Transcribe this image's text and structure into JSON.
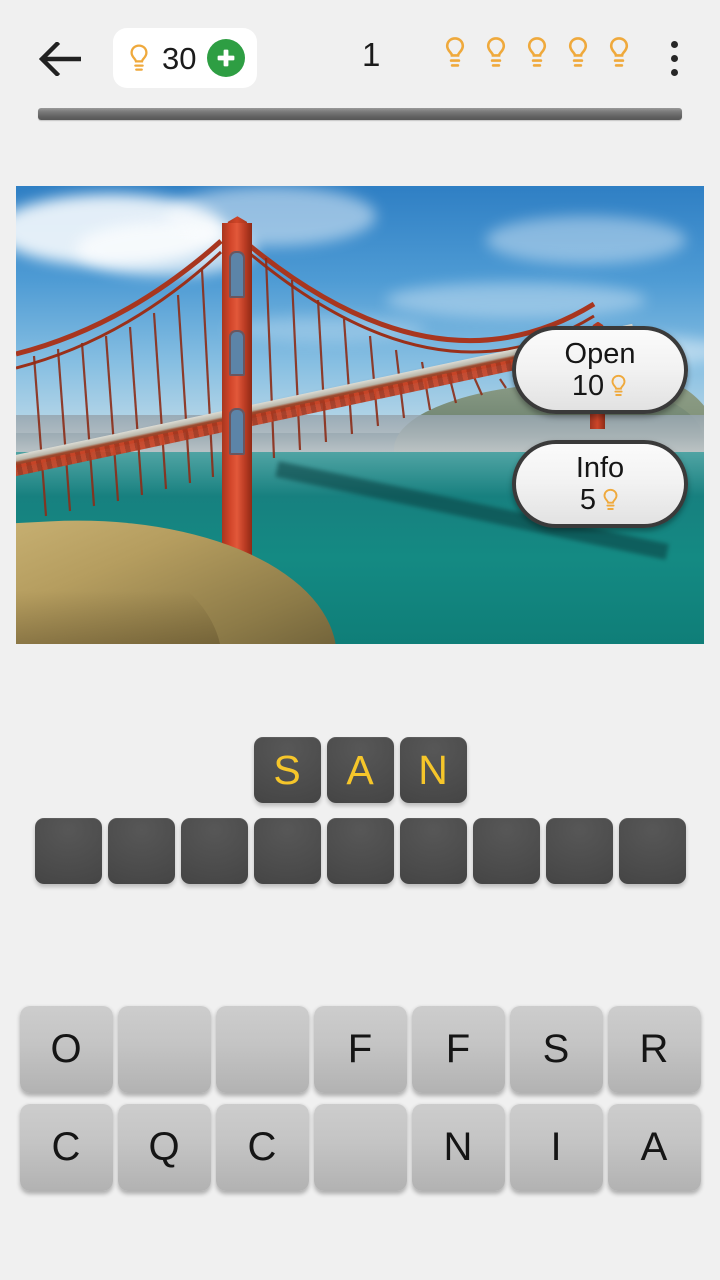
{
  "app": {
    "background_color": "#f0f0f0"
  },
  "topbar": {
    "back_icon": "back-arrow-icon",
    "hint_wallet": {
      "bulb_icon": "lightbulb-icon",
      "count": "30",
      "add_icon": "plus-icon"
    },
    "level": "1",
    "lives": {
      "icon": "lightbulb-icon",
      "count": 5,
      "color": "#efa93c"
    },
    "menu_icon": "kebab-menu-icon"
  },
  "progress": {
    "value": 100,
    "color": "#6e6e6e"
  },
  "photo": {
    "alt": "Golden Gate Bridge over San Francisco Bay",
    "sky_color": "#4e9bd4",
    "water_color": "#17807f",
    "bridge_color": "#cb4527"
  },
  "overlay_buttons": [
    {
      "name": "open",
      "label": "Open",
      "cost": "10",
      "bulb_icon": "lightbulb-icon"
    },
    {
      "name": "info",
      "label": "Info",
      "cost": "5",
      "bulb_icon": "lightbulb-icon"
    }
  ],
  "answer": {
    "letter_color": "#f6c62a",
    "tile_color": "#4c4c4c",
    "row1": [
      "S",
      "A",
      "N"
    ],
    "row2": [
      "",
      "",
      "",
      "",
      "",
      "",
      "",
      "",
      ""
    ]
  },
  "keyboard": {
    "key_color": "#c4c4c4",
    "rows": [
      [
        "O",
        "",
        "",
        "F",
        "F",
        "S",
        "R"
      ],
      [
        "C",
        "Q",
        "C",
        "",
        "N",
        "I",
        "A"
      ]
    ]
  }
}
